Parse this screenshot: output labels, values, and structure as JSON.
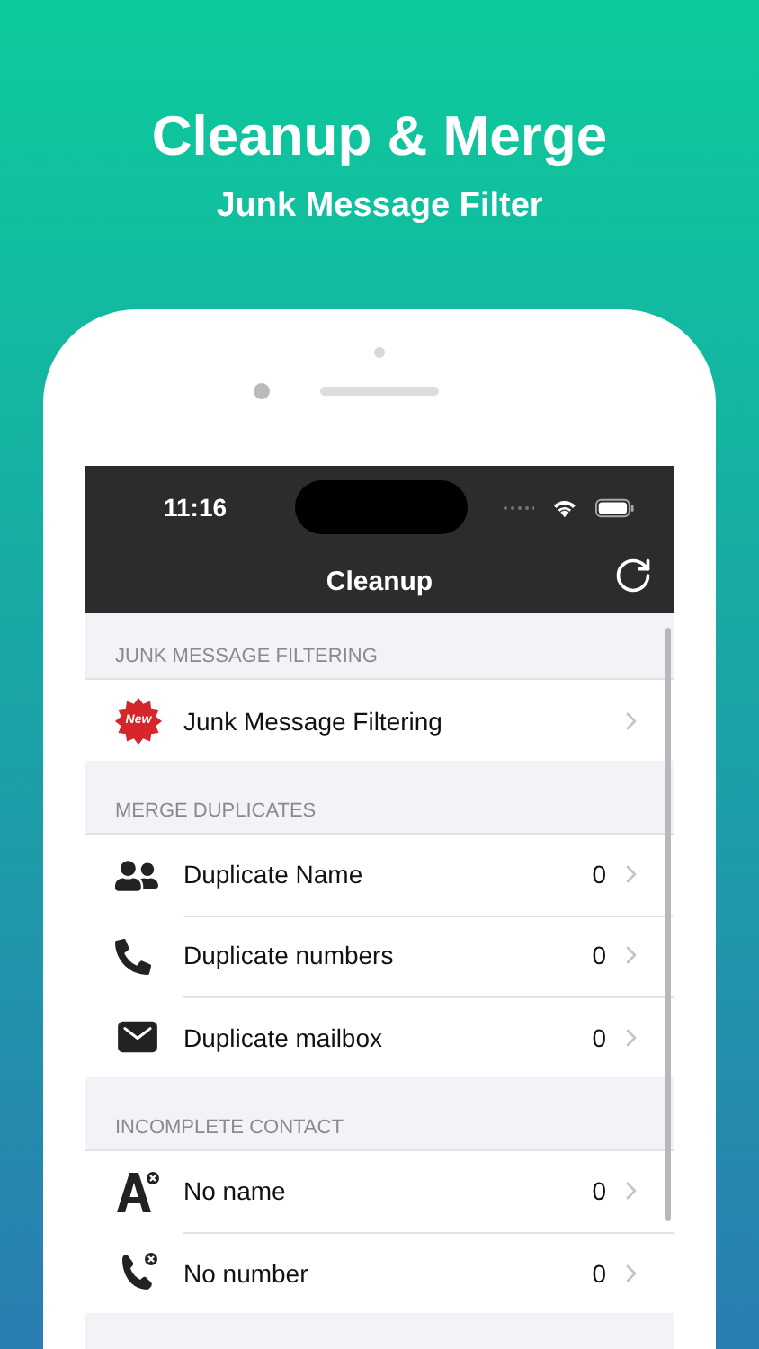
{
  "headline": {
    "title": "Cleanup & Merge",
    "subtitle": "Junk Message Filter"
  },
  "status_bar": {
    "time": "11:16"
  },
  "nav": {
    "title": "Cleanup"
  },
  "sections": [
    {
      "header": "JUNK MESSAGE FILTERING",
      "rows": [
        {
          "kind": "new",
          "badge": "New",
          "label": "Junk Message Filtering"
        }
      ]
    },
    {
      "header": "MERGE DUPLICATES",
      "rows": [
        {
          "kind": "people",
          "label": "Duplicate Name",
          "count": "0"
        },
        {
          "kind": "phone",
          "label": "Duplicate numbers",
          "count": "0"
        },
        {
          "kind": "mail",
          "label": "Duplicate mailbox",
          "count": "0"
        }
      ]
    },
    {
      "header": "INCOMPLETE CONTACT",
      "rows": [
        {
          "kind": "noname",
          "label": "No name",
          "count": "0"
        },
        {
          "kind": "nonumber",
          "label": "No number",
          "count": "0"
        }
      ]
    }
  ]
}
